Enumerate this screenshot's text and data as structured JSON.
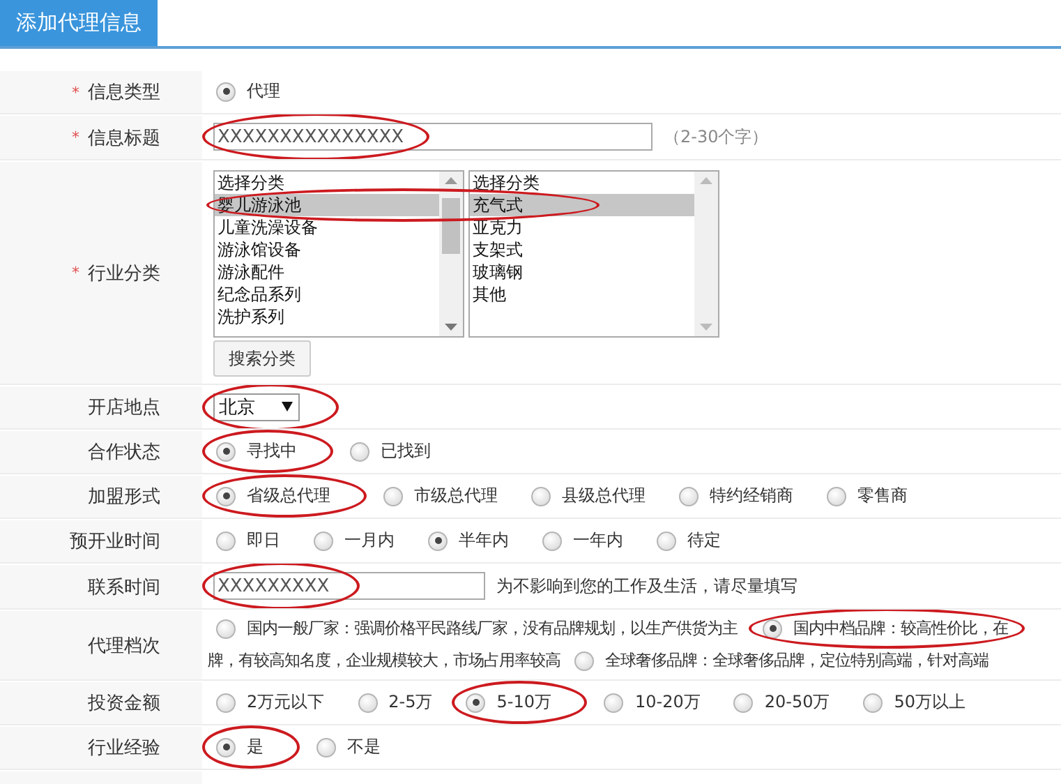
{
  "header": {
    "tab": "添加代理信息"
  },
  "rows": [
    {
      "kind": "radio",
      "label": "信息类型",
      "mark": "*",
      "options": [
        {
          "label": "代理",
          "selected": true
        }
      ]
    },
    {
      "kind": "text",
      "label": "信息标题",
      "mark": "*",
      "value": "XXXXXXXXXXXXXXX",
      "hint": "（2-30个字）",
      "annotated": true
    },
    {
      "kind": "category",
      "label": "行业分类",
      "mark": "*",
      "annotated": true,
      "button": "搜索分类",
      "lists": [
        {
          "scrollable": true,
          "items": [
            {
              "label": "选择分类",
              "selected": false
            },
            {
              "label": "婴儿游泳池",
              "selected": true
            },
            {
              "label": "儿童洗澡设备",
              "selected": false
            },
            {
              "label": "游泳馆设备",
              "selected": false
            },
            {
              "label": "游泳配件",
              "selected": false
            },
            {
              "label": "纪念品系列",
              "selected": false
            },
            {
              "label": "洗护系列",
              "selected": false
            }
          ]
        },
        {
          "scrollable": false,
          "items": [
            {
              "label": "选择分类",
              "selected": false
            },
            {
              "label": "充气式",
              "selected": true
            },
            {
              "label": "亚克力",
              "selected": false
            },
            {
              "label": "支架式",
              "selected": false
            },
            {
              "label": "玻璃钢",
              "selected": false
            },
            {
              "label": "其他",
              "selected": false
            }
          ]
        }
      ]
    },
    {
      "kind": "select",
      "label": "开店地点",
      "value": "北京",
      "annotated": true
    },
    {
      "kind": "radio",
      "label": "合作状态",
      "options": [
        {
          "label": "寻找中",
          "selected": true,
          "annotated": true
        },
        {
          "label": "已找到",
          "selected": false,
          "annotated": false
        }
      ]
    },
    {
      "kind": "radio",
      "label": "加盟形式",
      "options": [
        {
          "label": "省级总代理",
          "selected": true,
          "annotated": true
        },
        {
          "label": "市级总代理",
          "selected": false,
          "annotated": false
        },
        {
          "label": "县级总代理",
          "selected": false,
          "annotated": false
        },
        {
          "label": "特约经销商",
          "selected": false,
          "annotated": false
        },
        {
          "label": "零售商",
          "selected": false,
          "annotated": false
        }
      ]
    },
    {
      "kind": "radio",
      "label": "预开业时间",
      "options": [
        {
          "label": "即日",
          "selected": false
        },
        {
          "label": "一月内",
          "selected": false
        },
        {
          "label": "半年内",
          "selected": true
        },
        {
          "label": "一年内",
          "selected": false
        },
        {
          "label": "待定",
          "selected": false
        }
      ]
    },
    {
      "kind": "text",
      "label": "联系时间",
      "value": "XXXXXXXXX",
      "hint": "为不影响到您的工作及生活，请尽量填写",
      "annotated": true
    },
    {
      "kind": "tiers",
      "label": "代理档次",
      "options": [
        {
          "label": "国内一般厂家：强调价格平民路线厂家，没有品牌规划，以生产供货为主",
          "selected": false,
          "annotated": false
        },
        {
          "label": "国内中档品牌：较高性价比，在",
          "continuation": "牌，有较高知名度，企业规模较大，市场占用率较高",
          "selected": true,
          "annotated": true
        },
        {
          "label": "全球奢侈品牌：全球奢侈品牌，定位特别高端，针对高端",
          "selected": false,
          "annotated": false
        }
      ]
    },
    {
      "kind": "radio",
      "label": "投资金额",
      "options": [
        {
          "label": "2万元以下",
          "selected": false
        },
        {
          "label": "2-5万",
          "selected": false
        },
        {
          "label": "5-10万",
          "selected": true,
          "annotated": true
        },
        {
          "label": "10-20万",
          "selected": false
        },
        {
          "label": "20-50万",
          "selected": false
        },
        {
          "label": "50万以上",
          "selected": false
        }
      ]
    },
    {
      "kind": "radio",
      "label": "行业经验",
      "options": [
        {
          "label": "是",
          "selected": true,
          "annotated": true
        },
        {
          "label": "不是",
          "selected": false
        }
      ]
    }
  ]
}
